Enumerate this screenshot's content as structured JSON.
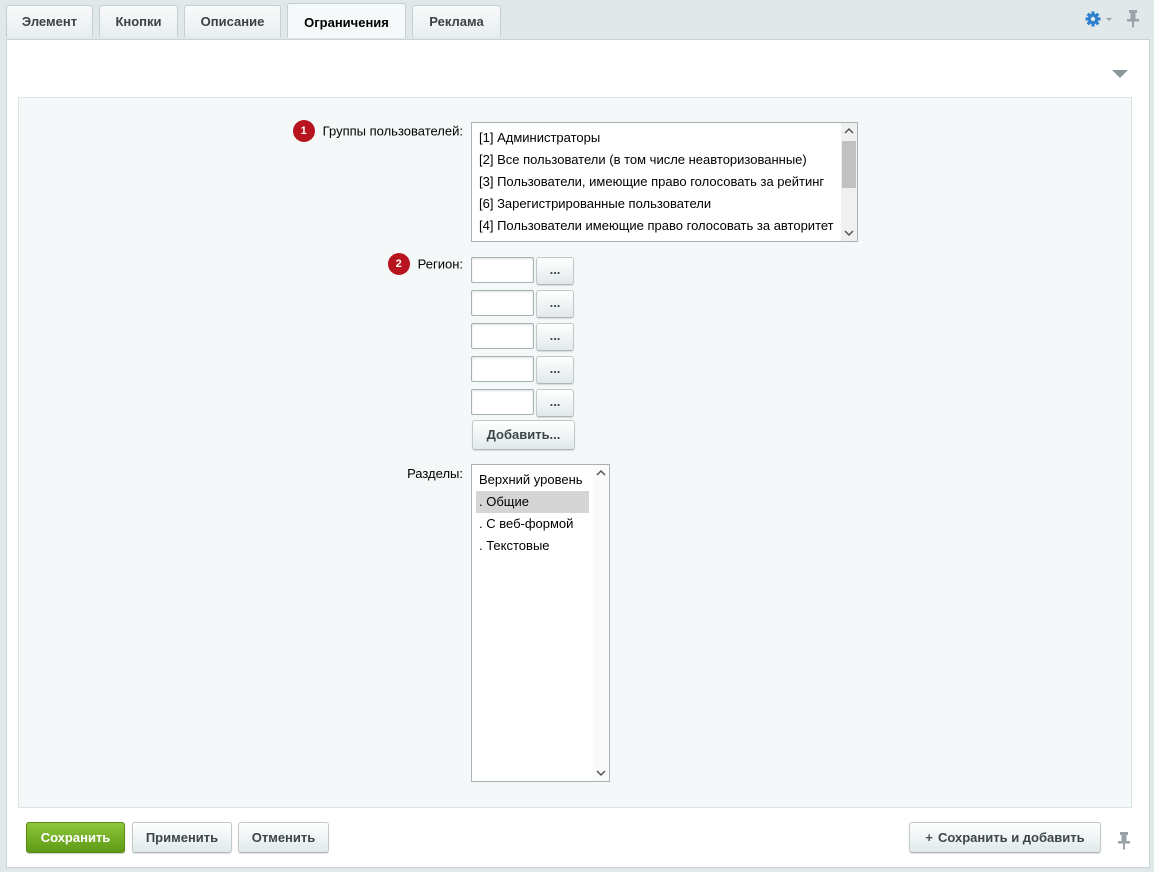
{
  "tabs": [
    {
      "label": "Элемент"
    },
    {
      "label": "Кнопки"
    },
    {
      "label": "Описание"
    },
    {
      "label": "Ограничения"
    },
    {
      "label": "Реклама"
    }
  ],
  "active_tab": "Ограничения",
  "icons": {
    "settings": "gear-icon",
    "pin": "pin-icon",
    "collapse": "triangle-down-icon"
  },
  "form": {
    "user_groups": {
      "badge": "1",
      "label": "Группы пользователей:",
      "options": [
        "[1] Администраторы",
        "[2] Все пользователи (в том числе неавторизованные)",
        "[3] Пользователи, имеющие право голосовать за рейтинг",
        "[6] Зарегистрированные пользователи",
        "[4] Пользователи имеющие право голосовать за авторитет"
      ]
    },
    "region": {
      "badge": "2",
      "label": "Регион:",
      "rows": [
        {
          "value": "",
          "button": "..."
        },
        {
          "value": "",
          "button": "..."
        },
        {
          "value": "",
          "button": "..."
        },
        {
          "value": "",
          "button": "..."
        },
        {
          "value": "",
          "button": "..."
        }
      ],
      "add_label": "Добавить..."
    },
    "sections": {
      "label": "Разделы:",
      "options": [
        "Верхний уровень",
        ". Общие",
        ". С веб-формой",
        ". Текстовые"
      ],
      "selected": ". Общие"
    }
  },
  "buttons": {
    "save": "Сохранить",
    "apply": "Применить",
    "cancel": "Отменить",
    "save_and_add": "Сохранить и добавить"
  },
  "colors": {
    "save_button": "#6fa923",
    "badge": "#b8141f",
    "background": "#e0e8ea",
    "form_background": "#f4f8f8"
  }
}
